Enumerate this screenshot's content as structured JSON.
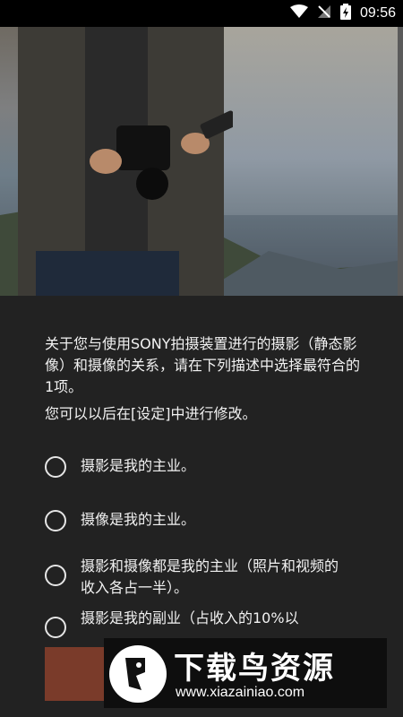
{
  "status_bar": {
    "time": "09:56"
  },
  "intro_text": "关于您与使用SONY拍摄装置进行的摄影（静态影像）和摄像的关系，请在下列描述中选择最符合的1项。",
  "settings_note": "您可以以后在[设定]中进行修改。",
  "options": [
    "摄影是我的主业。",
    "摄像是我的主业。",
    "摄影和摄像都是我的主业（照片和视频的收入各占一半）。",
    "摄影是我的副业（占收入的10%以"
  ],
  "watermark": {
    "title": "下载鸟资源",
    "url": "www.xiazainiao.com"
  }
}
